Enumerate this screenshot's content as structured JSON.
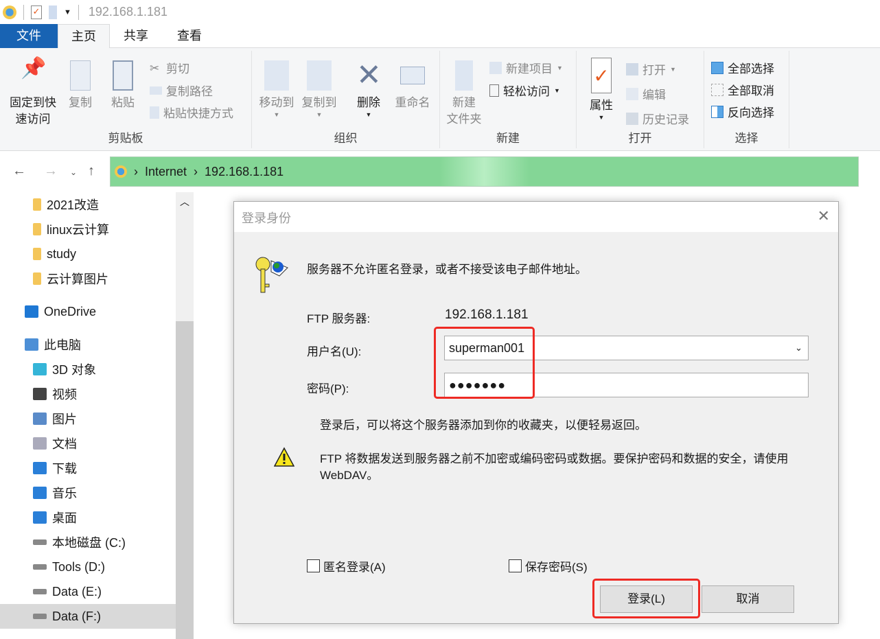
{
  "window": {
    "title": "192.168.1.181"
  },
  "tabs": [
    "文件",
    "主页",
    "共享",
    "查看"
  ],
  "ribbon": {
    "clipboard": {
      "label": "剪贴板",
      "pin": "固定到快\n速访问",
      "pin1": "固定到快",
      "pin2": "速访问",
      "copy": "复制",
      "paste": "粘贴",
      "cut": "剪切",
      "copy_path": "复制路径",
      "paste_shortcut": "粘贴快捷方式"
    },
    "organize": {
      "label": "组织",
      "move_to": "移动到",
      "copy_to": "复制到",
      "delete": "删除",
      "rename": "重命名"
    },
    "new": {
      "label": "新建",
      "new_folder1": "新建",
      "new_folder2": "文件夹",
      "new_item": "新建项目",
      "easy_access": "轻松访问"
    },
    "open": {
      "label": "打开",
      "properties": "属性",
      "open": "打开",
      "edit": "编辑",
      "history": "历史记录"
    },
    "select": {
      "label": "选择",
      "select_all": "全部选择",
      "select_none": "全部取消",
      "invert": "反向选择"
    }
  },
  "address": {
    "crumbs": [
      "Internet",
      "192.168.1.181"
    ]
  },
  "tree": [
    "2021改造",
    "linux云计算",
    "study",
    "云计算图片",
    "OneDrive",
    "此电脑",
    "3D 对象",
    "视频",
    "图片",
    "文档",
    "下载",
    "音乐",
    "桌面",
    "本地磁盘 (C:)",
    "Tools (D:)",
    "Data (E:)",
    "Data (F:)"
  ],
  "dialog": {
    "title": "登录身份",
    "message": "服务器不允许匿名登录，或者不接受该电子邮件地址。",
    "server_label": "FTP 服务器:",
    "server_value": "192.168.1.181",
    "user_label": "用户名(U):",
    "user_value": "superman001",
    "pass_label": "密码(P):",
    "pass_value": "●●●●●●●",
    "info": "登录后，可以将这个服务器添加到你的收藏夹，以便轻易返回。",
    "warning1": "FTP 将数据发送到服务器之前不加密或编码密码或数据。要保护密码和数据的安全，请使用",
    "warning2": "WebDAV。",
    "anon": "匿名登录(A)",
    "save": "保存密码(S)",
    "login": "登录(L)",
    "cancel": "取消"
  },
  "colors": {
    "file_tab": "#1863b3",
    "address_bar": "#84d696",
    "highlight": "#ee2a24"
  }
}
